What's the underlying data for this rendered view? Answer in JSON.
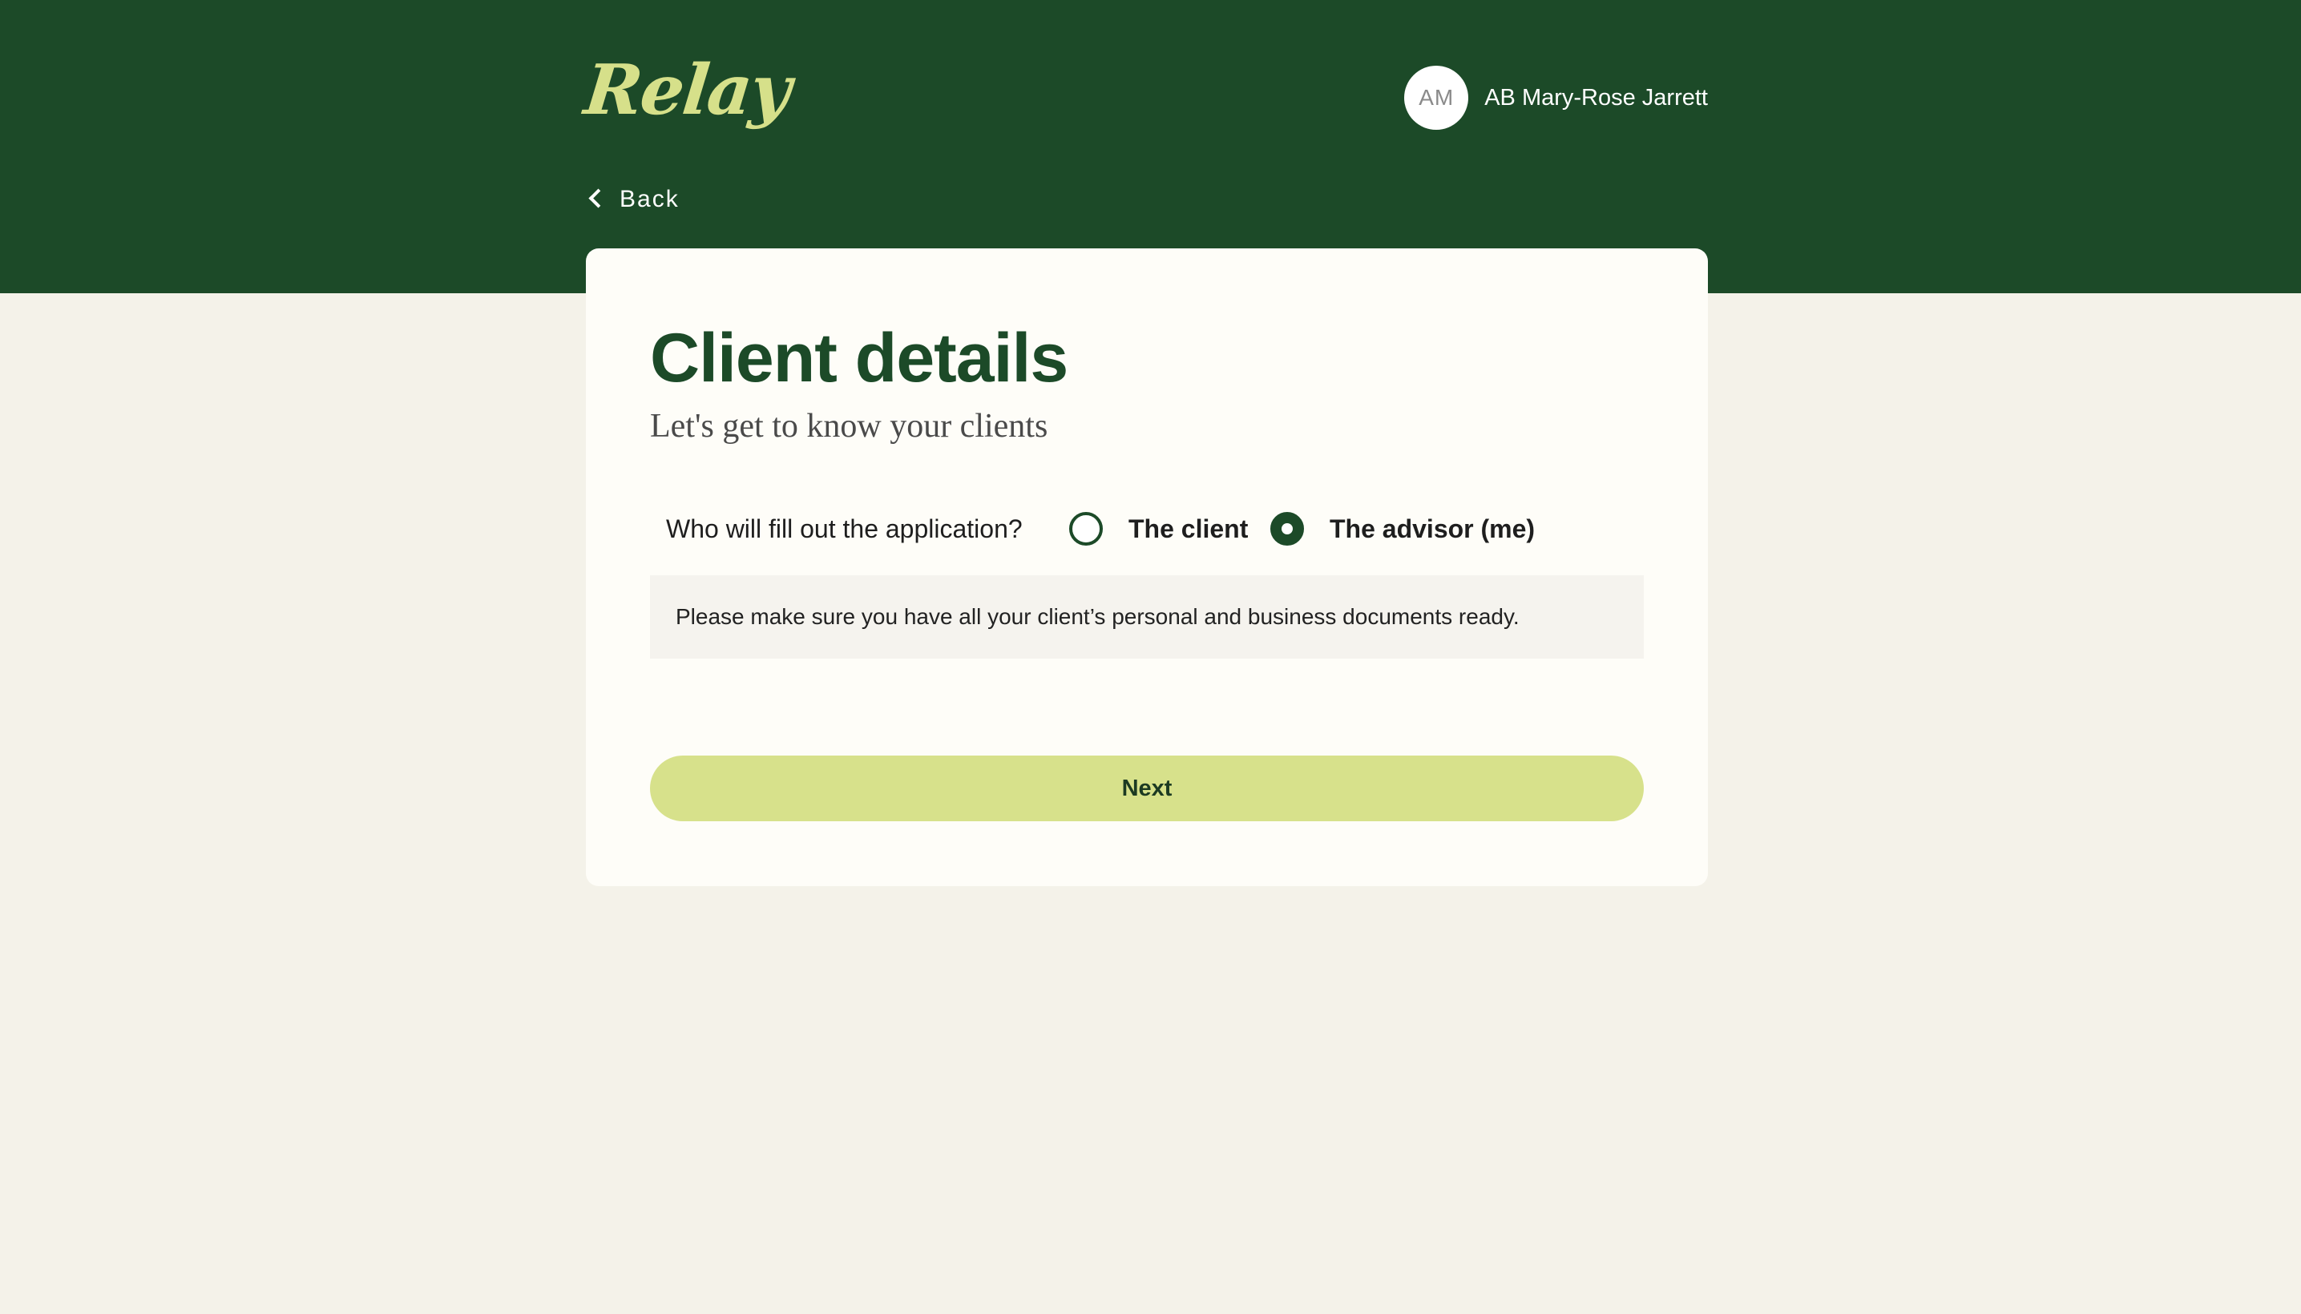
{
  "brand": {
    "logo_text": "Relay"
  },
  "user": {
    "avatar_initials": "AM",
    "name": "AB Mary-Rose Jarrett"
  },
  "nav": {
    "back_label": "Back"
  },
  "page": {
    "title": "Client details",
    "subtitle": "Let's get to know your clients"
  },
  "form": {
    "question": "Who will fill out the application?",
    "options": [
      {
        "label": "The client",
        "selected": false
      },
      {
        "label": "The advisor (me)",
        "selected": true
      }
    ],
    "notice": "Please make sure you have all your client’s personal and business documents ready.",
    "next_label": "Next"
  },
  "colors": {
    "brand_green": "#1c4a28",
    "accent_lime": "#d7e18b",
    "page_background": "#f4f2e9",
    "card_background": "#fefdf8"
  }
}
